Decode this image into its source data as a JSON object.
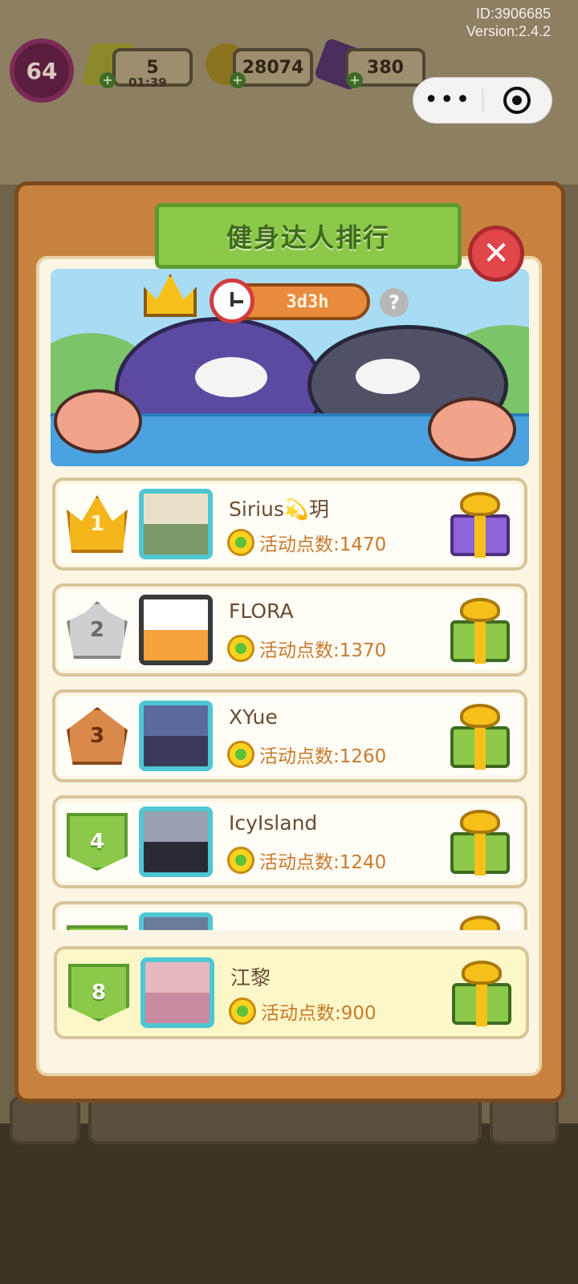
{
  "system": {
    "id_text": "ID:3906685",
    "version_text": "Version:2.4.2"
  },
  "hud": {
    "level": "64",
    "energy": "5",
    "energy_timer": "01:39",
    "coins": "28074",
    "gems": "380",
    "plus": "+"
  },
  "capsule": {
    "more_label": "•••"
  },
  "dialog": {
    "title": "健身达人排行",
    "close_label": "✕",
    "timer": "3d3h",
    "help_label": "?"
  },
  "rankings": [
    {
      "rank": "1",
      "name": "Sirius💫玥",
      "points_text": "活动点数:1470",
      "points": 1470,
      "badge": "gold",
      "gift": "purple-gift-icon"
    },
    {
      "rank": "2",
      "name": "FLORA",
      "points_text": "活动点数:1370",
      "points": 1370,
      "badge": "silver",
      "gift": "green-gift-icon"
    },
    {
      "rank": "3",
      "name": "XYue",
      "points_text": "活动点数:1260",
      "points": 1260,
      "badge": "bronze",
      "gift": "green-gift-icon"
    },
    {
      "rank": "4",
      "name": "IcyIsland",
      "points_text": "活动点数:1240",
      "points": 1240,
      "badge": "green",
      "gift": "green-gift-icon"
    }
  ],
  "self": {
    "rank": "8",
    "name": "江黎",
    "points_text": "活动点数:900",
    "points": 900,
    "gift": "green-gift-icon"
  },
  "colors": {
    "panel": "#c8823f",
    "title_ribbon": "#8cc94a",
    "close_button": "#e0464a",
    "points_text": "#c97a2c"
  }
}
